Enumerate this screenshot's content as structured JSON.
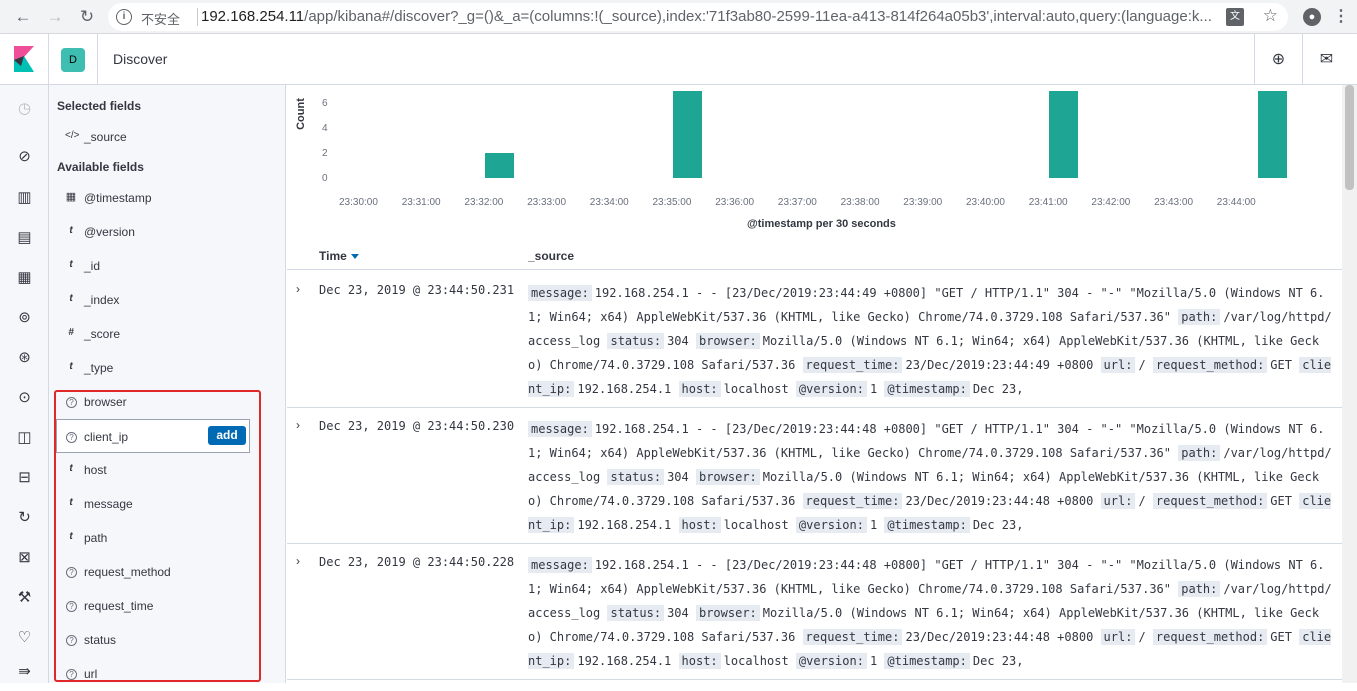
{
  "browser": {
    "insecure_label": "不安全",
    "url_host": "192.168.254.11",
    "url_path": "/app/kibana#/discover?_g=()&_a=(columns:!(_source),index:'71f3ab80-2599-11ea-a413-814f264a05b3',interval:auto,query:(language:k..."
  },
  "header": {
    "space_initial": "D",
    "breadcrumb": "Discover"
  },
  "sidebar": {
    "selected_title": "Selected fields",
    "selected": [
      {
        "type": "</>",
        "name": "_source"
      }
    ],
    "available_title": "Available fields",
    "available": [
      {
        "type": "cal",
        "name": "@timestamp"
      },
      {
        "type": "t",
        "name": "@version"
      },
      {
        "type": "t",
        "name": "_id"
      },
      {
        "type": "t",
        "name": "_index"
      },
      {
        "type": "#",
        "name": "_score"
      },
      {
        "type": "t",
        "name": "_type"
      },
      {
        "type": "?",
        "name": "browser"
      },
      {
        "type": "?",
        "name": "client_ip"
      },
      {
        "type": "t",
        "name": "host"
      },
      {
        "type": "t",
        "name": "message"
      },
      {
        "type": "t",
        "name": "path"
      },
      {
        "type": "?",
        "name": "request_method"
      },
      {
        "type": "?",
        "name": "request_time"
      },
      {
        "type": "?",
        "name": "status"
      },
      {
        "type": "?",
        "name": "url"
      }
    ],
    "add_label": "add"
  },
  "chart_data": {
    "type": "bar",
    "ylabel": "Count",
    "xlabel": "@timestamp per 30 seconds",
    "yticks": [
      "6",
      "4",
      "2",
      "0"
    ],
    "xticks": [
      "23:30:00",
      "23:31:00",
      "23:32:00",
      "23:33:00",
      "23:34:00",
      "23:35:00",
      "23:36:00",
      "23:37:00",
      "23:38:00",
      "23:39:00",
      "23:40:00",
      "23:41:00",
      "23:42:00",
      "23:43:00",
      "23:44:00"
    ],
    "bars": [
      {
        "x": "23:32:00",
        "value": 2
      },
      {
        "x": "23:35:00",
        "value": 7
      },
      {
        "x": "23:41:00",
        "value": 7
      },
      {
        "x": "23:44:30",
        "value": 7
      }
    ]
  },
  "table": {
    "time_header": "Time",
    "source_header": "_source",
    "rows": [
      {
        "time": "Dec 23, 2019 @ 23:44:50.231",
        "line1_key": "message:",
        "line1": "192.168.254.1 - - [23/Dec/2019:23:44:49 +0800] \"GET / HTTP/1.1\" 304 - \"-\" \"Mozilla/5.0 (Windows NT 6.1; Win64; x64) AppleWebKit/537.36 (KHTML, like Gecko) Chrome/74.0.3729.108 Safari/537.36\"",
        "path": "/var/log/httpd/access_log",
        "status": "304",
        "browser": "Mozilla/5.0 (Windows NT 6.1; Win64; x64) AppleWebKit/537.36 (KHTML, like Gecko) Chrome/74.0.3729.108 Safari/537.36",
        "request_time": "23/Dec/2019:23:44:49 +0800",
        "url": "/",
        "request_method": "GET",
        "client_ip": "192.168.254.1",
        "host": "localhost",
        "version": "1",
        "timestamp": "Dec 23,"
      },
      {
        "time": "Dec 23, 2019 @ 23:44:50.230",
        "line1_key": "message:",
        "line1": "192.168.254.1 - - [23/Dec/2019:23:44:48 +0800] \"GET / HTTP/1.1\" 304 - \"-\" \"Mozilla/5.0 (Windows NT 6.1; Win64; x64) AppleWebKit/537.36 (KHTML, like Gecko) Chrome/74.0.3729.108 Safari/537.36\"",
        "path": "/var/log/httpd/access_log",
        "status": "304",
        "browser": "Mozilla/5.0 (Windows NT 6.1; Win64; x64) AppleWebKit/537.36 (KHTML, like Gecko) Chrome/74.0.3729.108 Safari/537.36",
        "request_time": "23/Dec/2019:23:44:48 +0800",
        "url": "/",
        "request_method": "GET",
        "client_ip": "192.168.254.1",
        "host": "localhost",
        "version": "1",
        "timestamp": "Dec 23,"
      },
      {
        "time": "Dec 23, 2019 @ 23:44:50.228",
        "line1_key": "message:",
        "line1": "192.168.254.1 - - [23/Dec/2019:23:44:48 +0800] \"GET / HTTP/1.1\" 304 - \"-\" \"Mozilla/5.0 (Windows NT 6.1; Win64; x64) AppleWebKit/537.36 (KHTML, like Gecko) Chrome/74.0.3729.108 Safari/537.36\"",
        "path": "/var/log/httpd/access_log",
        "status": "304",
        "browser": "Mozilla/5.0 (Windows NT 6.1; Win64; x64) AppleWebKit/537.36 (KHTML, like Gecko) Chrome/74.0.3729.108 Safari/537.36",
        "request_time": "23/Dec/2019:23:44:48 +0800",
        "url": "/",
        "request_method": "GET",
        "client_ip": "192.168.254.1",
        "host": "localhost",
        "version": "1",
        "timestamp": "Dec 23,"
      }
    ]
  },
  "colors": {
    "accent": "#006bb4",
    "bar": "#1ea593",
    "highlight": "#e0282a"
  }
}
